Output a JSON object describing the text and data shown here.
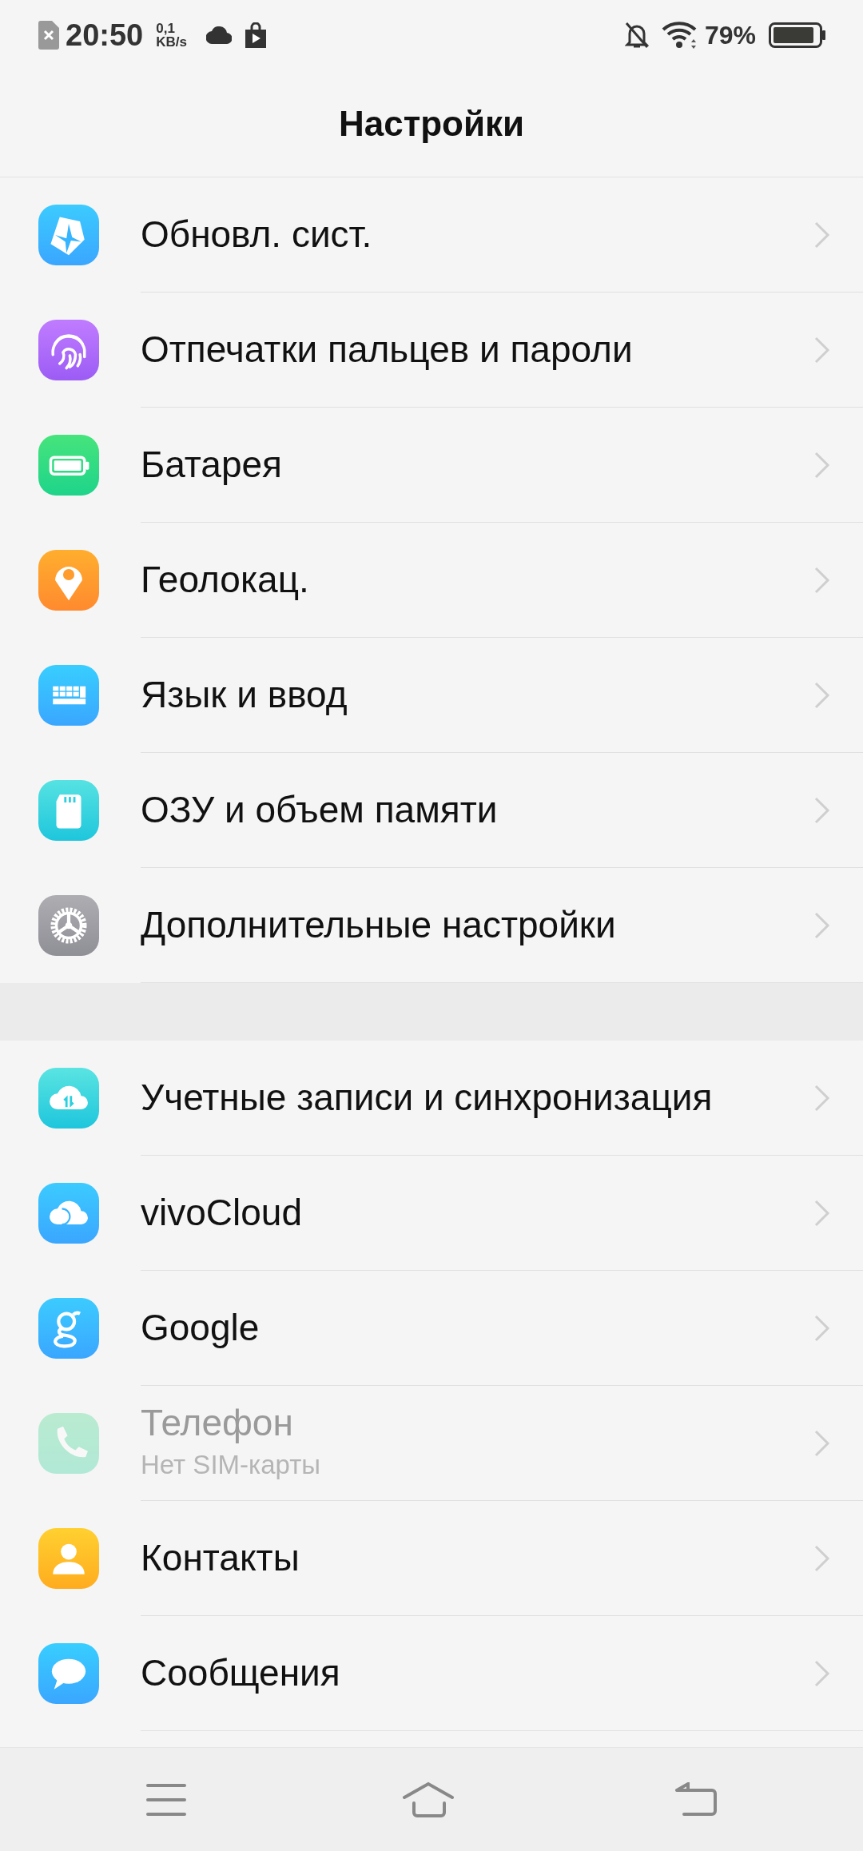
{
  "status_bar": {
    "time": "20:50",
    "speed": "0,1",
    "speed_unit": "KB/s",
    "battery": "79%"
  },
  "header": {
    "title": "Настройки"
  },
  "sections": [
    {
      "items": [
        {
          "label": "Обновл. сист.",
          "disabled": false
        },
        {
          "label": "Отпечатки пальцев и пароли",
          "disabled": false
        },
        {
          "label": "Батарея",
          "disabled": false
        },
        {
          "label": "Геолокац.",
          "disabled": false
        },
        {
          "label": "Язык и ввод",
          "disabled": false
        },
        {
          "label": "ОЗУ и объем памяти",
          "disabled": false
        },
        {
          "label": "Дополнительные настройки",
          "disabled": false
        }
      ]
    },
    {
      "items": [
        {
          "label": "Учетные записи и синхронизация",
          "disabled": false
        },
        {
          "label": "vivoCloud",
          "disabled": false
        },
        {
          "label": "Google",
          "disabled": false
        },
        {
          "label": "Телефон",
          "subtitle": "Нет SIM-карты",
          "disabled": true
        },
        {
          "label": "Контакты",
          "disabled": false
        },
        {
          "label": "Сообщения",
          "disabled": false
        }
      ]
    }
  ]
}
